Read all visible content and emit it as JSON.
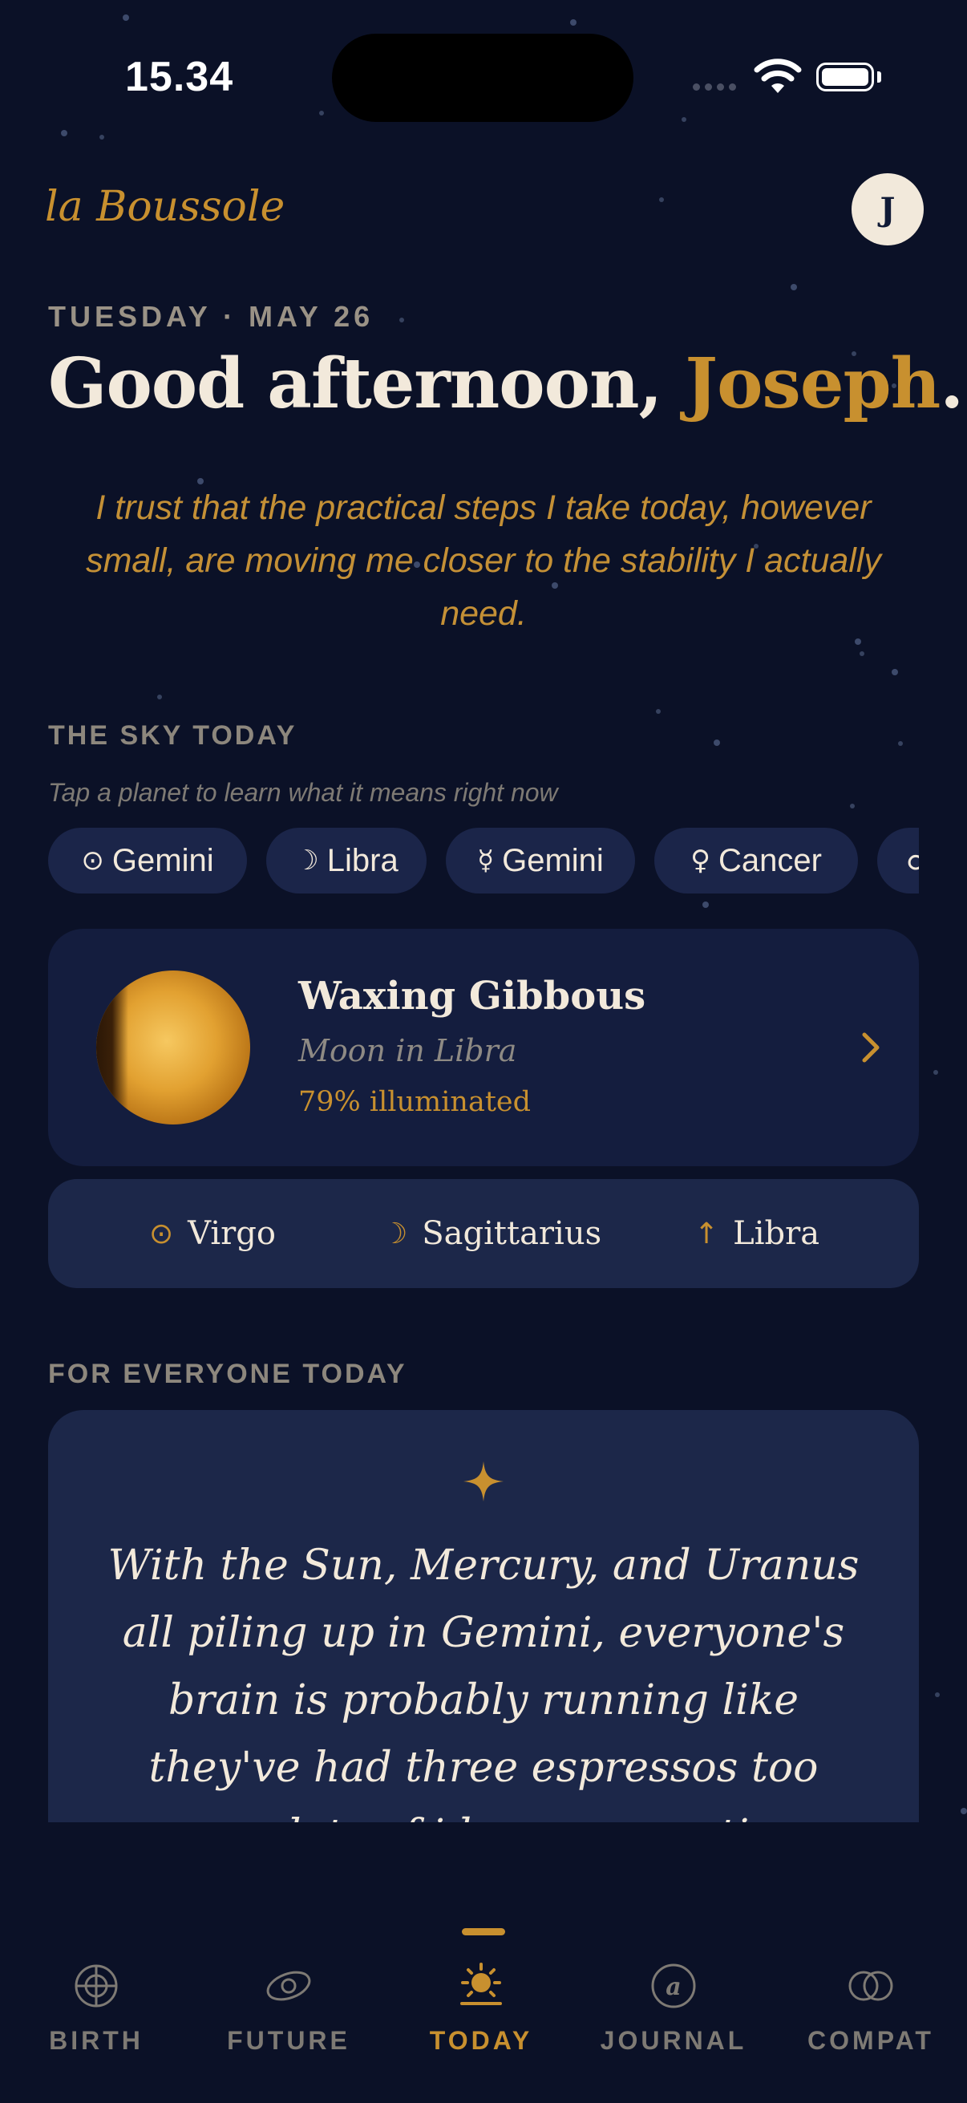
{
  "status_bar": {
    "time": "15.34"
  },
  "header": {
    "brand": "la Boussole",
    "avatar_initial": "J"
  },
  "greeting": {
    "date": "TUESDAY · MAY 26",
    "prefix": "Good afternoon, ",
    "name": "Joseph",
    "suffix": "."
  },
  "affirmation": "I trust that the practical steps I take today, however small, are moving me closer to the stability I actually need.",
  "sky": {
    "title": "THE SKY TODAY",
    "subtitle": "Tap a planet to learn what it means right now",
    "chips": [
      {
        "glyph": "⊙",
        "icon": "sun-icon",
        "label": "Gemini"
      },
      {
        "glyph": "☽",
        "icon": "moon-icon",
        "label": "Libra"
      },
      {
        "glyph": "☿",
        "icon": "mercury-icon",
        "label": "Gemini"
      },
      {
        "glyph": "♀",
        "icon": "venus-icon",
        "label": "Cancer"
      },
      {
        "glyph": "♂",
        "icon": "mars-icon",
        "label": ""
      }
    ]
  },
  "moon_card": {
    "title": "Waxing Gibbous",
    "subtitle": "Moon in Libra",
    "illumination": "79% illuminated",
    "illumination_fraction": 0.79
  },
  "big_three": [
    {
      "glyph": "⊙",
      "icon": "sun-icon",
      "label": "Virgo"
    },
    {
      "glyph": "☽",
      "icon": "moon-icon",
      "label": "Sagittarius"
    },
    {
      "glyph": "↑",
      "icon": "rising-arrow-icon",
      "label": "Libra"
    }
  ],
  "everyone": {
    "title": "FOR EVERYONE TODAY",
    "text": "With the Sun, Mercury, and Uranus all piling up in Gemini, everyone's brain is probably running like they've had three espressos too many—lots of ideas, connections, and information flying"
  },
  "tabs": [
    {
      "label": "BIRTH",
      "icon": "birth-chart-icon",
      "active": false
    },
    {
      "label": "FUTURE",
      "icon": "orbit-icon",
      "active": false
    },
    {
      "label": "TODAY",
      "icon": "sun-icon",
      "active": true
    },
    {
      "label": "JOURNAL",
      "icon": "journal-at-icon",
      "active": false
    },
    {
      "label": "COMPAT",
      "icon": "compatibility-rings-icon",
      "active": false
    }
  ],
  "colors": {
    "background": "#0b1127",
    "accent_gold": "#c8902f",
    "card": "#1c2749",
    "text_light": "#f2e9db",
    "muted": "#8d877d"
  }
}
